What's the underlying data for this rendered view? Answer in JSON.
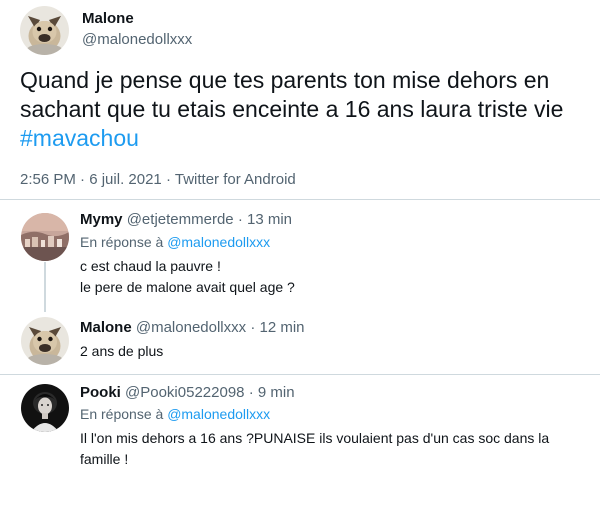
{
  "main_tweet": {
    "author_name": "Malone",
    "author_handle": "@malonedollxxx",
    "text_lines": [
      "Quand je pense que tes parents ton mise dehors en",
      "sachant que tu etais enceinte a 16 ans laura triste vie"
    ],
    "hashtag": "#mavachou",
    "time": "2:56 PM",
    "separator": "·",
    "date": "6 juil. 2021",
    "source": "Twitter for Android"
  },
  "replies": [
    {
      "name": "Mymy",
      "handle": "@etjetemmerde",
      "separator": "·",
      "age": "13 min",
      "reply_prefix": "En réponse à",
      "reply_to": "@malonedollxxx",
      "text_lines": [
        "c est chaud la pauvre !",
        "le pere de malone avait quel age ?"
      ]
    },
    {
      "name": "Malone",
      "handle": "@malonedollxxx",
      "separator": "·",
      "age": "12 min",
      "text_lines": [
        "2 ans de plus"
      ]
    },
    {
      "name": "Pooki",
      "handle": "@Pooki05222098",
      "separator": "·",
      "age": "9 min",
      "reply_prefix": "En réponse à",
      "reply_to": "@malonedollxxx",
      "text_lines": [
        "Il l'on mis dehors a 16 ans ?PUNAISE  ils voulaient pas d'un cas soc dans la",
        "famille !"
      ]
    }
  ],
  "colors": {
    "text": "#0f1419",
    "secondary": "#536471",
    "link": "#1d9bf0",
    "divider": "#cfd9de"
  },
  "icons": {
    "main_avatar": "bulldog-avatar-icon",
    "reply1_avatar": "city-landscape-avatar-icon",
    "reply2_avatar": "bulldog-avatar-icon",
    "reply3_avatar": "portrait-avatar-icon"
  }
}
